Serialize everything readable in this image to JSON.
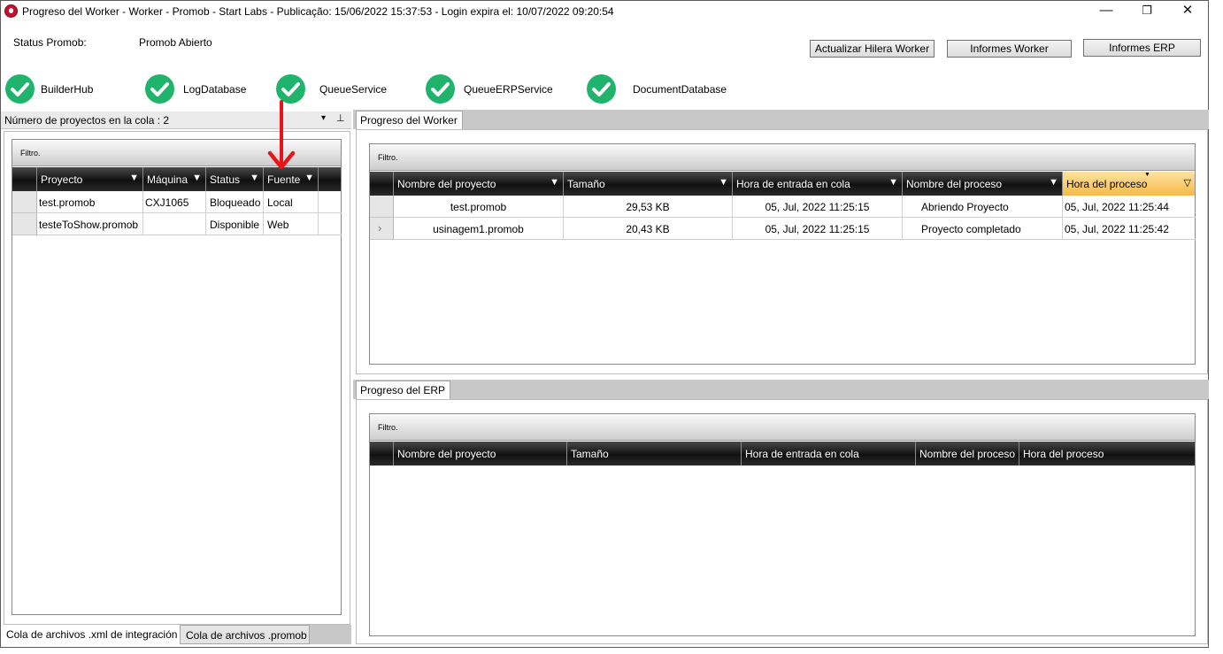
{
  "titlebar": {
    "title": "Progreso del Worker  -  Worker - Promob  -  Start Labs  -  Publicação: 15/06/2022 15:37:53 - Login expira el: 10/07/2022 09:20:54",
    "minimize": "—",
    "maximize": "❐",
    "close": "✕"
  },
  "status": {
    "label": "Status Promob:",
    "value": "Promob Abierto"
  },
  "buttons": {
    "refresh": "Actualizar Hilera Worker",
    "worker_reports": "Informes Worker",
    "erp_reports": "Informes ERP"
  },
  "services": [
    {
      "name": "BuilderHub",
      "ok": true
    },
    {
      "name": "LogDatabase",
      "ok": true
    },
    {
      "name": "QueueService",
      "ok": true
    },
    {
      "name": "QueueERPService",
      "ok": true
    },
    {
      "name": "DocumentDatabase",
      "ok": true
    }
  ],
  "queue_panel": {
    "title": "Número de proyectos en la cola : 2",
    "dropdown_icon": "▾",
    "pin_icon": "⊥",
    "filter_label": "Filtro.",
    "columns": [
      "Proyecto",
      "Máquina",
      "Status",
      "Fuente"
    ],
    "rows": [
      {
        "proyecto": "test.promob",
        "maquina": "CXJ1065",
        "status": "Bloqueado",
        "fuente": "Local"
      },
      {
        "proyecto": "testeToShow.promob",
        "maquina": "",
        "status": "Disponible",
        "fuente": "Web"
      }
    ]
  },
  "bottom_tabs": [
    "Cola de archivos .xml de integración",
    "Cola de archivos .promob"
  ],
  "worker_progress": {
    "tab": "Progreso del Worker",
    "filter_label": "Filtro.",
    "columns": [
      "Nombre del proyecto",
      "Tamaño",
      "Hora de entrada en cola",
      "Nombre del proceso",
      "Hora del proceso"
    ],
    "rows": [
      {
        "marker": "",
        "nombre": "test.promob",
        "tamano": "29,53 KB",
        "entrada": "05, Jul, 2022 11:25:15",
        "proceso": "Abriendo Proyecto",
        "hora": "05, Jul, 2022 11:25:44"
      },
      {
        "marker": "›",
        "nombre": "usinagem1.promob",
        "tamano": "20,43 KB",
        "entrada": "05, Jul, 2022 11:25:15",
        "proceso": "Proyecto completado",
        "hora": "05, Jul, 2022 11:25:42"
      }
    ]
  },
  "erp_progress": {
    "tab": "Progreso del ERP",
    "filter_label": "Filtro.",
    "columns": [
      "Nombre del proyecto",
      "Tamaño",
      "Hora de entrada en cola",
      "Nombre del proceso",
      "Hora del proceso"
    ]
  },
  "colors": {
    "check_green": "#1fb36c",
    "annotation_arrow": "#e8141a",
    "header_dark": "#1a1a1a",
    "highlight_header": "#f7b94a"
  }
}
